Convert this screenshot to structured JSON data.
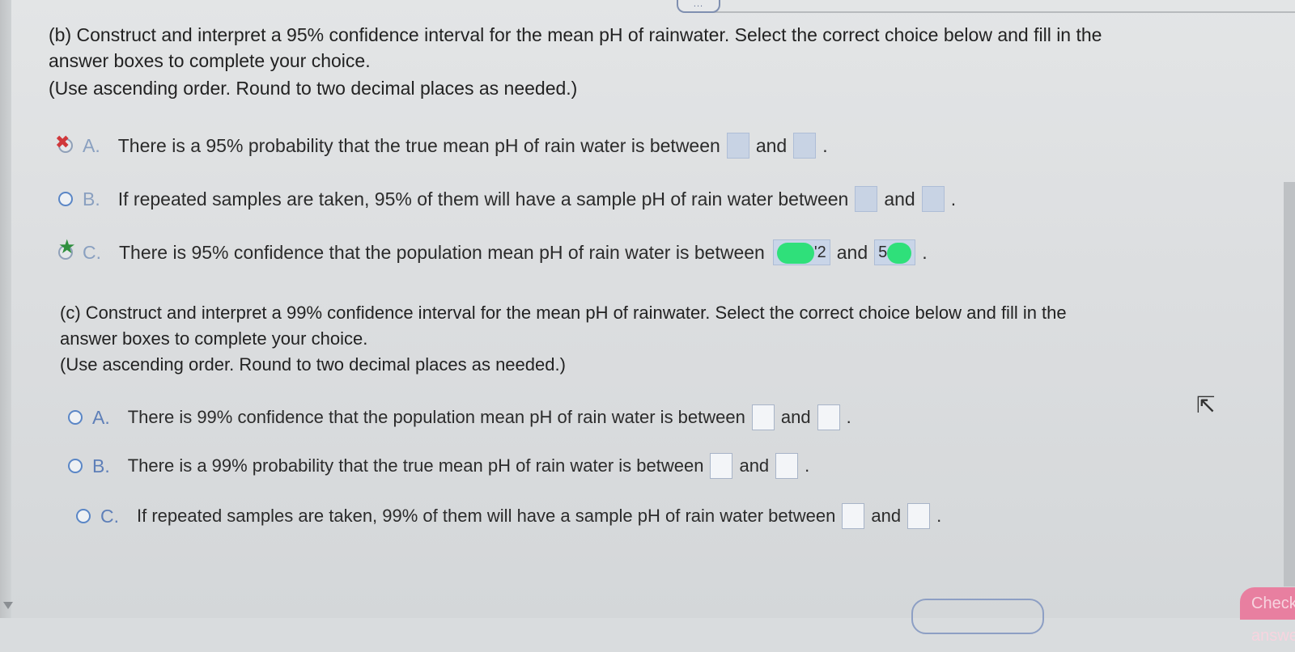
{
  "part_b": {
    "line1": "(b) Construct and interpret a 95% confidence interval for the mean pH of rainwater. Select the correct choice below and fill in the",
    "line2": "answer boxes to complete your choice.",
    "line3": "(Use ascending order. Round to two decimal places as needed.)",
    "choices": [
      {
        "letter": "A.",
        "text": "There is a 95% probability that the true mean pH of rain water is between",
        "and": "and",
        "end": "."
      },
      {
        "letter": "B.",
        "text": "If repeated samples are taken, 95% of them will have a sample pH of rain water between",
        "and": "and",
        "end": "."
      },
      {
        "letter": "C.",
        "text": "There is 95% confidence that the population mean pH of rain water is between",
        "value1_partial": "'2",
        "and": "and",
        "value2_partial": "5",
        "end": "."
      }
    ]
  },
  "part_c": {
    "line1": "(c) Construct and interpret a 99% confidence interval for the mean pH of rainwater. Select the correct choice below and fill in the",
    "line2": "answer boxes to complete your choice.",
    "line3": "(Use ascending order. Round to two decimal places as needed.)",
    "choices": [
      {
        "letter": "A.",
        "text": "There is 99% confidence that the population mean pH of rain water is between",
        "and": "and",
        "end": "."
      },
      {
        "letter": "B.",
        "text": "There is a 99% probability that the true mean pH of rain water is between",
        "and": "and",
        "end": "."
      },
      {
        "letter": "C.",
        "text": "If repeated samples are taken, 99% of them will have a sample pH of rain water between",
        "and": "and",
        "end": "."
      }
    ]
  },
  "toolbar": {
    "more_label": "...",
    "check_answer": "Check answer"
  },
  "colors": {
    "accent": "#5a86c6",
    "incorrect": "#d0383b",
    "correct": "#2f8f3e",
    "check_button": "#e87fa0"
  }
}
